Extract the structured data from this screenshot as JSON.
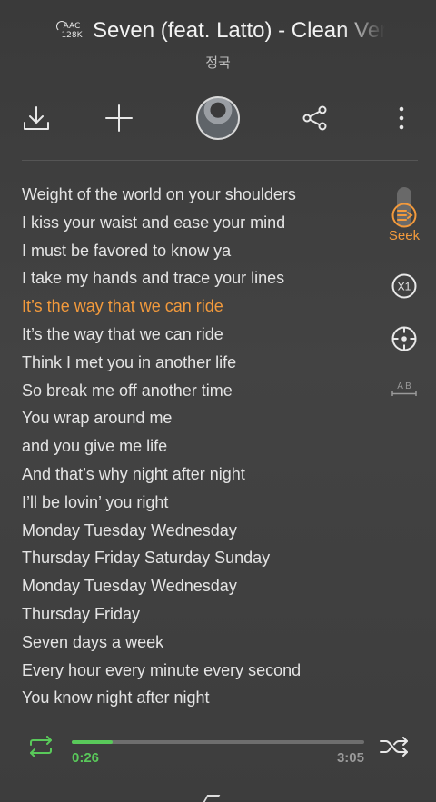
{
  "header": {
    "quality_top": "AAC",
    "quality_bottom": "128K",
    "title": "Seven (feat. Latto) - Clean Version",
    "artist": "정국"
  },
  "toolbar": {
    "icons": [
      "download-icon",
      "add-icon",
      "artist-avatar",
      "share-icon",
      "more-icon"
    ]
  },
  "lyrics": {
    "active_index": 4,
    "lines": [
      "Weight of the world on your shoulders",
      "I kiss your waist and ease your mind",
      "I must be favored to know ya",
      "I take my hands and trace your lines",
      "It’s the way that we can ride",
      "It’s the way that we can ride",
      "Think I met you in another life",
      "So break me off another time",
      "You wrap around me",
      "and you give me life",
      "And that’s why night after night",
      "I’ll be lovin’ you right",
      "Monday Tuesday Wednesday",
      "Thursday Friday Saturday Sunday",
      "Monday Tuesday Wednesday",
      "Thursday Friday",
      "Seven days a week",
      "Every hour every minute every second",
      "You know night after night"
    ]
  },
  "side_controls": {
    "seek_label": "Seek",
    "speed_label": "X1",
    "ab_label": "A B"
  },
  "player": {
    "current_time": "0:26",
    "total_time": "3:05",
    "progress": 0.1405
  },
  "colors": {
    "accent_orange": "#f39a3c",
    "accent_green": "#59c95a"
  }
}
